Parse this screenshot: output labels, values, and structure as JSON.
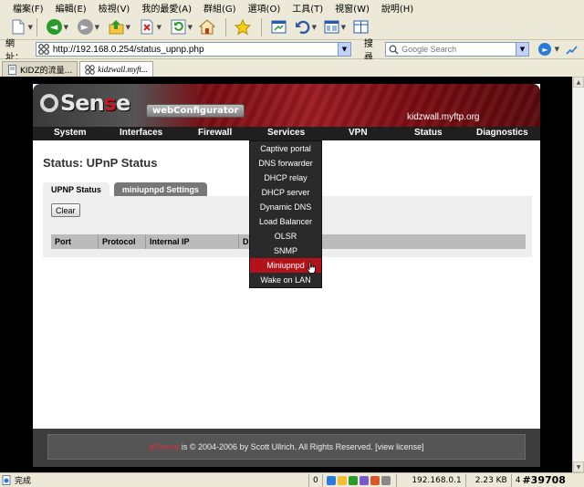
{
  "menu": [
    "檔案(F)",
    "編輯(E)",
    "檢視(V)",
    "我的最愛(A)",
    "群組(G)",
    "選項(O)",
    "工具(T)",
    "視窗(W)",
    "說明(H)"
  ],
  "toolbar": {
    "new_icon": "new-page-icon",
    "back_icon": "back-arrow-icon",
    "forward_icon": "forward-arrow-icon"
  },
  "address": {
    "label": "網址：",
    "url": "http://192.168.0.254/status_upnp.php"
  },
  "search": {
    "label": "搜尋",
    "placeholder": "Google Search"
  },
  "tabs": [
    {
      "label": "KIDZ的流量..."
    },
    {
      "label": "kidzwall.myft..."
    }
  ],
  "pfsense": {
    "logo_main": "Sen",
    "logo_accent": "s",
    "logo_end": "e",
    "webconfigurator": "webConfigurator",
    "hostname": "kidzwall.myftp.org",
    "nav": [
      "System",
      "Interfaces",
      "Firewall",
      "Services",
      "VPN",
      "Status",
      "Diagnostics"
    ],
    "page_title": "Status: UPnP Status",
    "page_tabs": [
      {
        "label": "UPNP Status",
        "active": true
      },
      {
        "label": "miniupnpd Settings",
        "active": false
      }
    ],
    "clear_button": "Clear",
    "table_headers": [
      "Port",
      "Protocol",
      "Internal IP",
      "D"
    ],
    "services_menu": [
      "Captive portal",
      "DNS forwarder",
      "DHCP relay",
      "DHCP server",
      "Dynamic DNS",
      "Load Balancer",
      "OLSR",
      "SNMP",
      "Miniupnpd",
      "Wake on LAN"
    ],
    "hovered_item": "Miniupnpd",
    "footer_brand": "pfSense",
    "footer_text": " is © 2004-2006 by Scott Ullrich. All Rights Reserved. [view license]"
  },
  "statusbar": {
    "status": "完成",
    "count": "0",
    "ip": "192.168.0.1",
    "size": "2.23 KB",
    "extra": "4",
    "watermark": "#39708"
  },
  "colors": {
    "accent_red": "#b4121a",
    "nav_bg": "#1f1f1f"
  }
}
